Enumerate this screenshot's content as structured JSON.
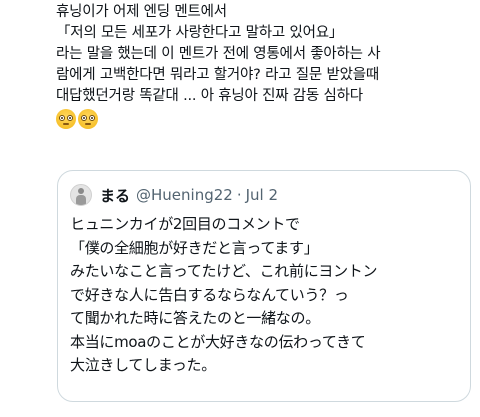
{
  "tweet": {
    "lines": [
      "휴닝이가 어제 엔딩 멘트에서",
      "「저의 모든 세포가 사랑한다고 말하고 있어요」",
      "라는 말을 했는데 이 멘트가 전에 영통에서 좋아하는 사",
      "람에게 고백한다면 뭐라고 할거야? 라고 질문 받았을때",
      "대답했던거랑 똑같대 ... 아 휴닝아 진짜 감동 심하다"
    ],
    "emojis": [
      "pleading-face-emoji",
      "pleading-face-emoji"
    ]
  },
  "quote": {
    "author_name": "まる",
    "handle": "@Huening22",
    "separator": "·",
    "date": "Jul 2",
    "lines": [
      "ヒュニンカイが2回目のコメントで",
      "「僕の全細胞が好きだと言ってます」",
      "みたいなこと言ってたけど、これ前にヨントン",
      "で好きな人に告白するならなんていう？っ",
      "て聞かれた時に答えたのと一緒なの。",
      "本当にmoaのことが大好きなの伝わってきて",
      "大泣きしてしまった。"
    ]
  }
}
